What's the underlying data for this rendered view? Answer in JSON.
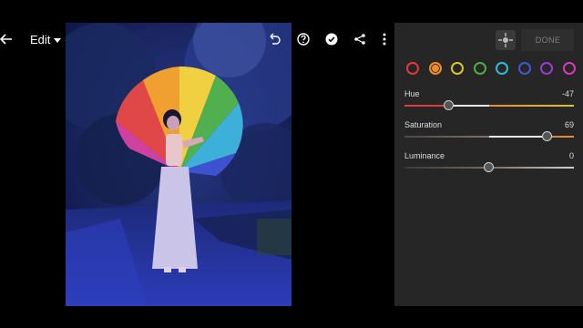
{
  "header": {
    "edit_label": "Edit",
    "back_icon": "back-arrow-icon",
    "undo_icon": "undo-icon",
    "help_icon": "help-icon",
    "apply_icon": "check-circle-icon",
    "share_icon": "share-icon",
    "more_icon": "more-vertical-icon"
  },
  "panel": {
    "done_label": "DONE",
    "target_icon": "targeted-adjustment-icon",
    "swatches": [
      {
        "name": "red",
        "color": "#e03a3a",
        "selected": false
      },
      {
        "name": "orange",
        "color": "#f08b2c",
        "selected": true
      },
      {
        "name": "yellow",
        "color": "#d9c52c",
        "selected": false
      },
      {
        "name": "green",
        "color": "#4cae44",
        "selected": false
      },
      {
        "name": "aqua",
        "color": "#34b9d6",
        "selected": false
      },
      {
        "name": "blue",
        "color": "#3d58d6",
        "selected": false
      },
      {
        "name": "purple",
        "color": "#9a3bd8",
        "selected": false
      },
      {
        "name": "magenta",
        "color": "#d63bbd",
        "selected": false
      }
    ],
    "sliders": [
      {
        "label": "Hue",
        "value": "-47",
        "fraction": 0.265
      },
      {
        "label": "Saturation",
        "value": "69",
        "fraction": 0.845
      },
      {
        "label": "Luminance",
        "value": "0",
        "fraction": 0.5
      }
    ]
  }
}
